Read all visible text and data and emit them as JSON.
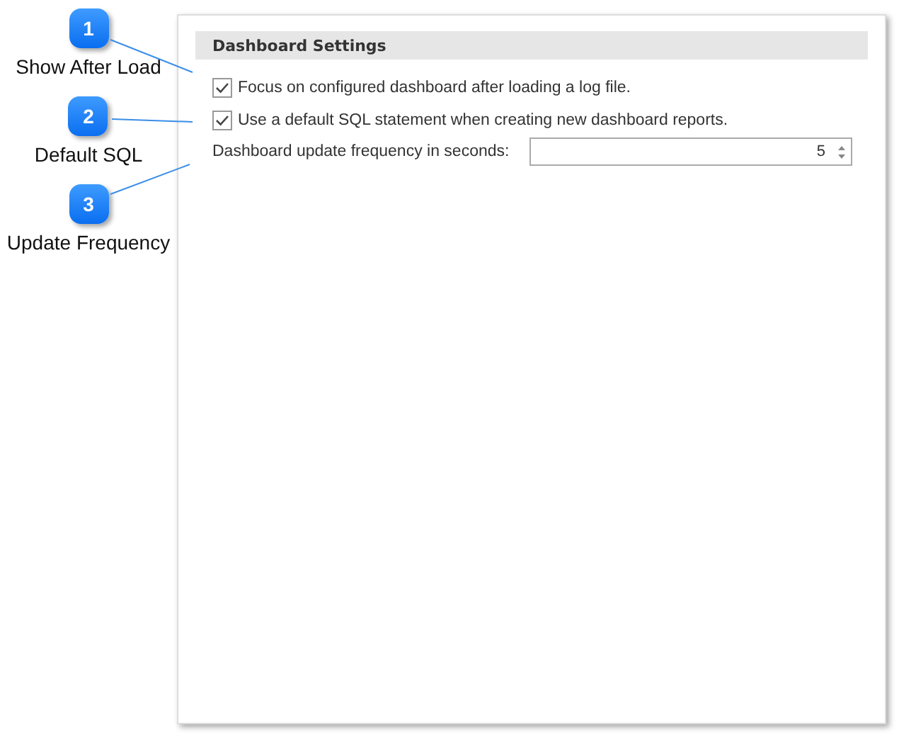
{
  "callouts": [
    {
      "number": "1",
      "label": "Show After Load"
    },
    {
      "number": "2",
      "label": "Default SQL"
    },
    {
      "number": "3",
      "label": "Update Frequency"
    }
  ],
  "panel": {
    "section_title": "Dashboard Settings",
    "options": [
      {
        "label": "Focus on configured dashboard after loading a log file.",
        "checked": true
      },
      {
        "label": "Use a default SQL statement when creating new dashboard reports.",
        "checked": true
      }
    ],
    "frequency": {
      "label": "Dashboard update frequency in seconds:",
      "value": "5"
    }
  }
}
